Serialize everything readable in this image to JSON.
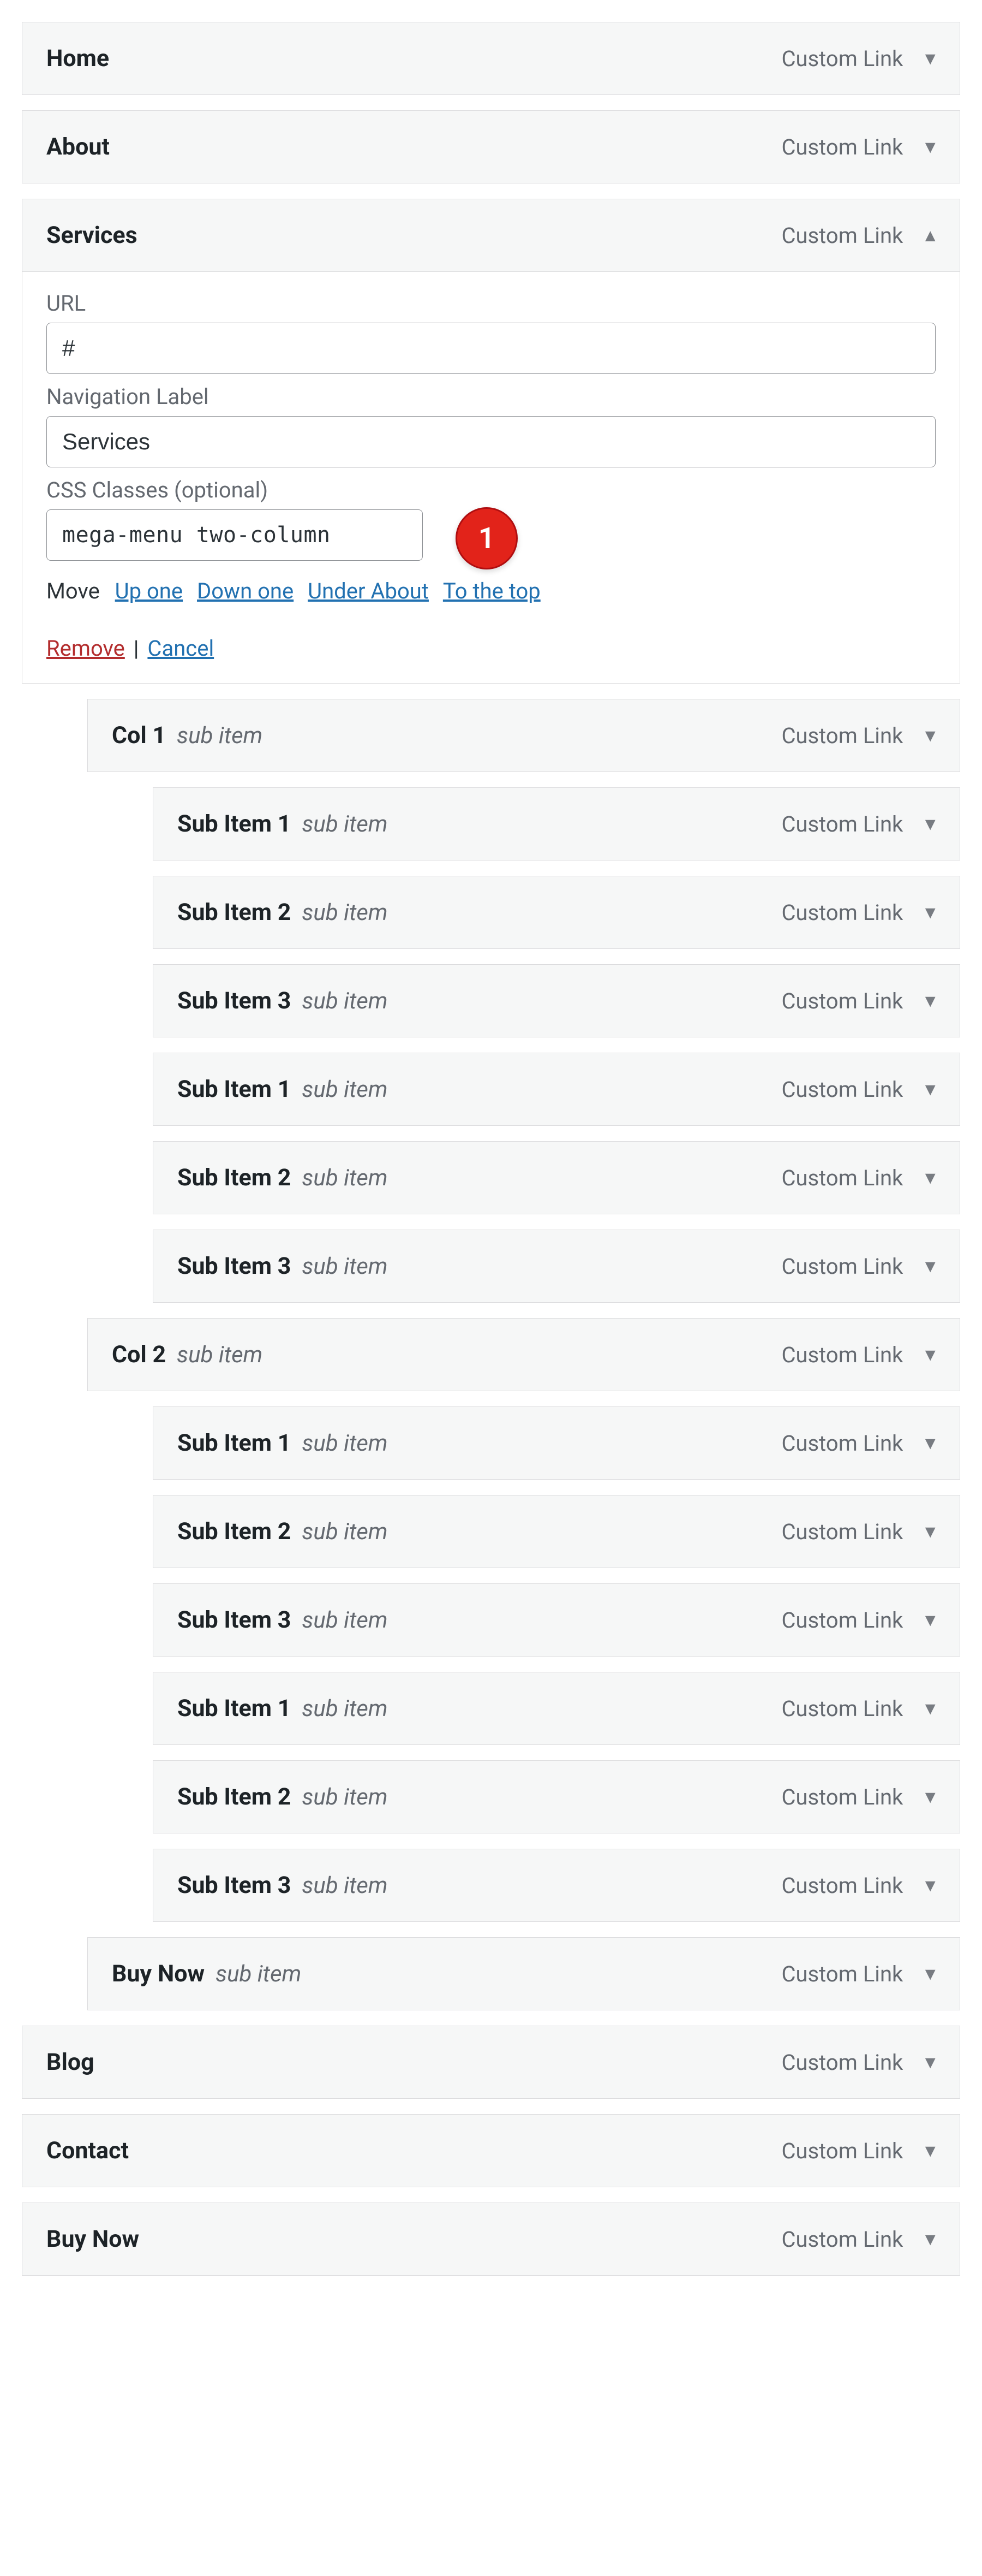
{
  "menu": {
    "type_label": "Custom Link",
    "items": [
      {
        "title": "Home",
        "sub": "",
        "depth": 0,
        "expanded": false
      },
      {
        "title": "About",
        "sub": "",
        "depth": 0,
        "expanded": false
      },
      {
        "title": "Services",
        "sub": "",
        "depth": 0,
        "expanded": true,
        "settings": {
          "url_label": "URL",
          "url_value": "#",
          "nav_label": "Navigation Label",
          "nav_value": "Services",
          "css_label": "CSS Classes (optional)",
          "css_value": "mega-menu two-column",
          "annotation": "1",
          "move_label": "Move",
          "move_up": "Up one",
          "move_down": "Down one",
          "move_under": "Under About",
          "move_top": "To the top",
          "remove": "Remove",
          "cancel": "Cancel"
        }
      },
      {
        "title": "Col 1",
        "sub": "sub item",
        "depth": 1,
        "expanded": false
      },
      {
        "title": "Sub Item 1",
        "sub": "sub item",
        "depth": 2,
        "expanded": false
      },
      {
        "title": "Sub Item 2",
        "sub": "sub item",
        "depth": 2,
        "expanded": false
      },
      {
        "title": "Sub Item 3",
        "sub": "sub item",
        "depth": 2,
        "expanded": false
      },
      {
        "title": "Sub Item 1",
        "sub": "sub item",
        "depth": 2,
        "expanded": false
      },
      {
        "title": "Sub Item 2",
        "sub": "sub item",
        "depth": 2,
        "expanded": false
      },
      {
        "title": "Sub Item 3",
        "sub": "sub item",
        "depth": 2,
        "expanded": false
      },
      {
        "title": "Col 2",
        "sub": "sub item",
        "depth": 1,
        "expanded": false
      },
      {
        "title": "Sub Item 1",
        "sub": "sub item",
        "depth": 2,
        "expanded": false
      },
      {
        "title": "Sub Item 2",
        "sub": "sub item",
        "depth": 2,
        "expanded": false
      },
      {
        "title": "Sub Item 3",
        "sub": "sub item",
        "depth": 2,
        "expanded": false
      },
      {
        "title": "Sub Item 1",
        "sub": "sub item",
        "depth": 2,
        "expanded": false
      },
      {
        "title": "Sub Item 2",
        "sub": "sub item",
        "depth": 2,
        "expanded": false
      },
      {
        "title": "Sub Item 3",
        "sub": "sub item",
        "depth": 2,
        "expanded": false
      },
      {
        "title": "Buy Now",
        "sub": "sub item",
        "depth": 1,
        "expanded": false
      },
      {
        "title": "Blog",
        "sub": "",
        "depth": 0,
        "expanded": false
      },
      {
        "title": "Contact",
        "sub": "",
        "depth": 0,
        "expanded": false
      },
      {
        "title": "Buy Now",
        "sub": "",
        "depth": 0,
        "expanded": false
      }
    ]
  }
}
